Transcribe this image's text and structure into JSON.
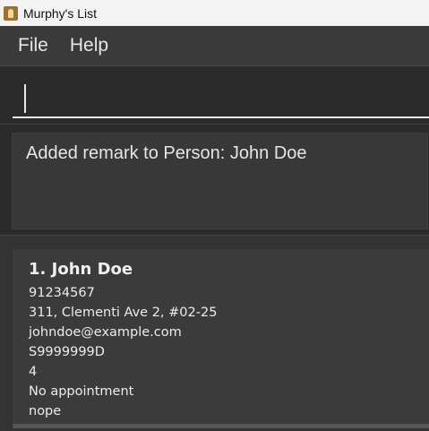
{
  "window": {
    "title": "Murphy's List",
    "icon": "app-person-icon"
  },
  "menu": {
    "items": [
      "File",
      "Help"
    ]
  },
  "command": {
    "value": "",
    "placeholder": ""
  },
  "result": {
    "message": "Added remark to Person: John Doe"
  },
  "person_list": [
    {
      "index_name": "1. John Doe",
      "phone": "91234567",
      "address": "311, Clementi Ave 2, #02-25",
      "email": "johndoe@example.com",
      "nric": "S9999999D",
      "field_4": "4",
      "appointment": "No appointment",
      "remark": "nope"
    }
  ]
}
